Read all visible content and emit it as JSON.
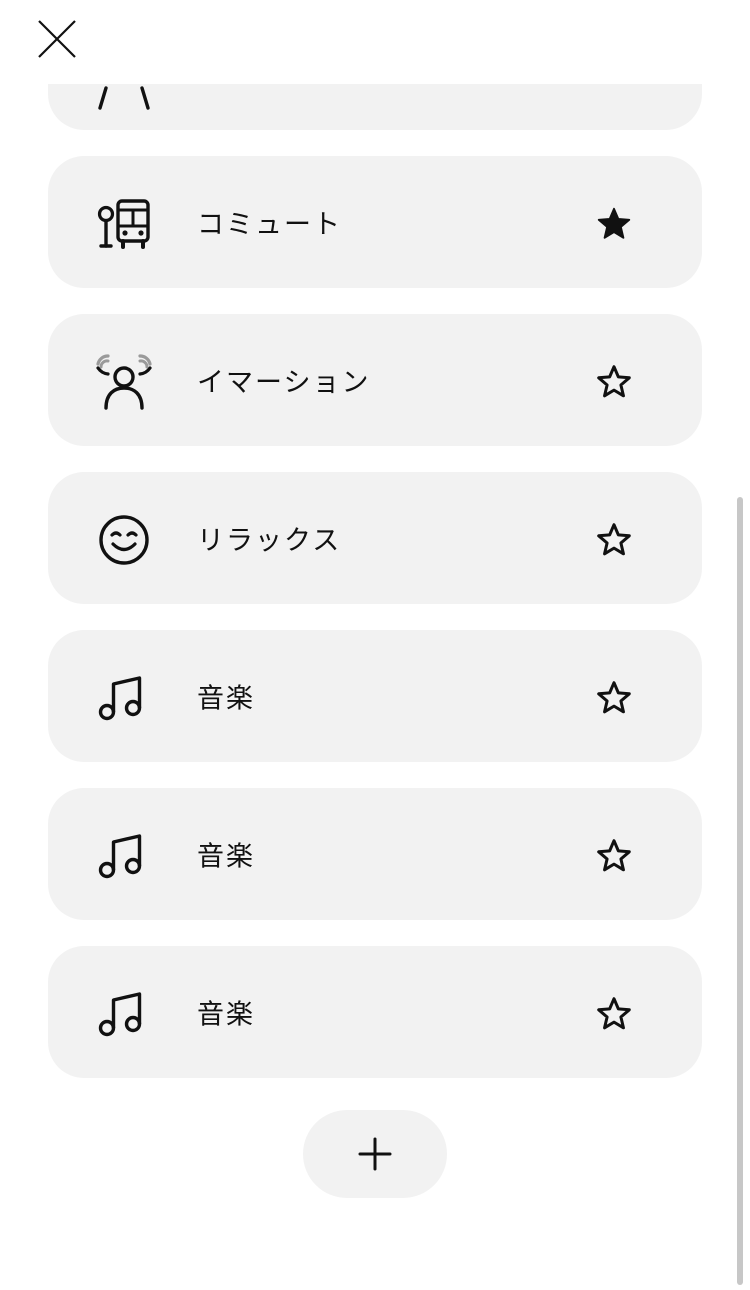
{
  "header": {
    "close_icon": "close-icon"
  },
  "modes": [
    {
      "id": "partial",
      "label": "",
      "icon": "partial-person-icon",
      "favorite": false
    },
    {
      "id": "commute",
      "label": "コミュート",
      "icon": "bus-stop-icon",
      "favorite": true
    },
    {
      "id": "immersion",
      "label": "イマーション",
      "icon": "immersive-person-icon",
      "favorite": false
    },
    {
      "id": "relax",
      "label": "リラックス",
      "icon": "smiley-face-icon",
      "favorite": false
    },
    {
      "id": "music1",
      "label": "音楽",
      "icon": "music-note-icon",
      "favorite": false
    },
    {
      "id": "music2",
      "label": "音楽",
      "icon": "music-note-icon",
      "favorite": false
    },
    {
      "id": "music3",
      "label": "音楽",
      "icon": "music-note-icon",
      "favorite": false
    }
  ],
  "add_button": {
    "icon": "plus-icon"
  },
  "colors": {
    "card_bg": "#f2f2f2",
    "icon": "#111111",
    "accent_gray": "#9a9a9a",
    "scrollbar": "#c7c7c7"
  }
}
